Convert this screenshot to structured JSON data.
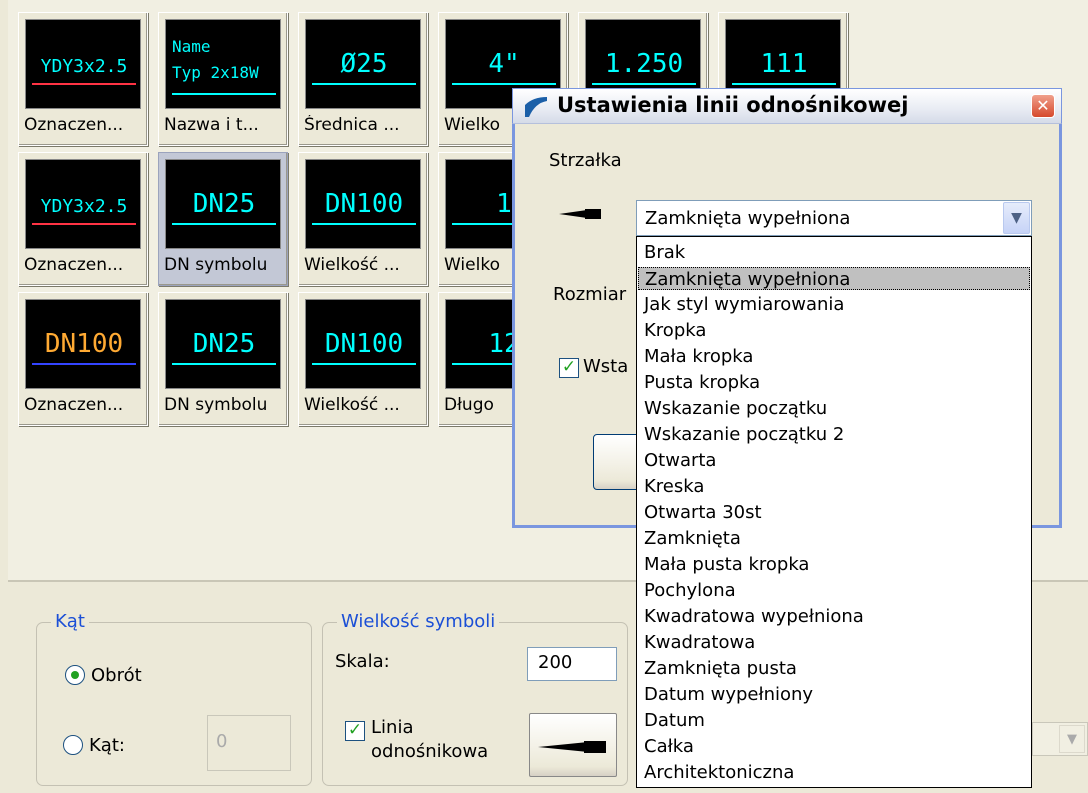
{
  "tiles": [
    {
      "label": "Oznaczen...",
      "thumb_lines": [
        "YDY3x2.5"
      ],
      "thumb_color": "#00ffff"
    },
    {
      "label": "Nazwa i t...",
      "thumb_lines": [
        "Name",
        "Typ 2x18W"
      ],
      "thumb_color": "#00ffff"
    },
    {
      "label": "Średnica ...",
      "thumb_lines": [
        "Ø25"
      ],
      "thumb_color": "#00ffff"
    },
    {
      "label": "Wielko",
      "thumb_lines": [
        "4\""
      ],
      "thumb_color": "#00ffff"
    },
    {
      "label": "",
      "thumb_lines": [
        "1.250"
      ],
      "thumb_color": "#00ffff"
    },
    {
      "label": "",
      "thumb_lines": [
        "111"
      ],
      "thumb_color": "#00ffff"
    },
    {
      "label": "Oznaczen...",
      "thumb_lines": [
        "YDY3x2.5"
      ],
      "thumb_color": "#00ffff"
    },
    {
      "label": "DN symbolu",
      "thumb_lines": [
        "DN25"
      ],
      "thumb_color": "#00ffff"
    },
    {
      "label": "Wielkość ...",
      "thumb_lines": [
        "DN100"
      ],
      "thumb_color": "#00ffff"
    },
    {
      "label": "Wielko",
      "thumb_lines": [
        "1"
      ],
      "thumb_color": "#00ffff"
    },
    {
      "label": "Oznaczen...",
      "thumb_lines": [
        "DN100"
      ],
      "thumb_color": "#ffaa33"
    },
    {
      "label": "DN symbolu",
      "thumb_lines": [
        "DN25"
      ],
      "thumb_color": "#00ffff"
    },
    {
      "label": "Wielkość ...",
      "thumb_lines": [
        "DN100"
      ],
      "thumb_color": "#00ffff"
    },
    {
      "label": "Długo",
      "thumb_lines": [
        "12"
      ],
      "thumb_color": "#00ffff"
    }
  ],
  "angle_group": {
    "title": "Kąt",
    "rotation_label": "Obrót",
    "angle_label": "Kąt:",
    "angle_value": "0"
  },
  "symbol_size_group": {
    "title": "Wielkość symboli",
    "scale_label": "Skala:",
    "scale_value": "200",
    "leader_label_1": "Linia",
    "leader_label_2": "odnośnikowa"
  },
  "dialog": {
    "title": "Ustawienia linii odnośnikowej",
    "close_glyph": "✕",
    "arrow_label": "Strzałka",
    "size_label": "Rozmiar",
    "insert_label": "Wsta",
    "selected_arrow": "Zamknięta wypełniona",
    "arrow_options": [
      "Brak",
      "Zamknięta wypełniona",
      "Jak styl wymiarowania",
      "Kropka",
      "Mała kropka",
      "Pusta kropka",
      "Wskazanie początku",
      "Wskazanie początku 2",
      "Otwarta",
      "Kreska",
      "Otwarta 30st",
      "Zamknięta",
      "Mała pusta kropka",
      "Pochylona",
      "Kwadratowa wypełniona",
      "Kwadratowa",
      "Zamknięta pusta",
      "Datum wypełniony",
      "Datum",
      "Całka",
      "Architektoniczna"
    ],
    "selected_index": 1
  }
}
